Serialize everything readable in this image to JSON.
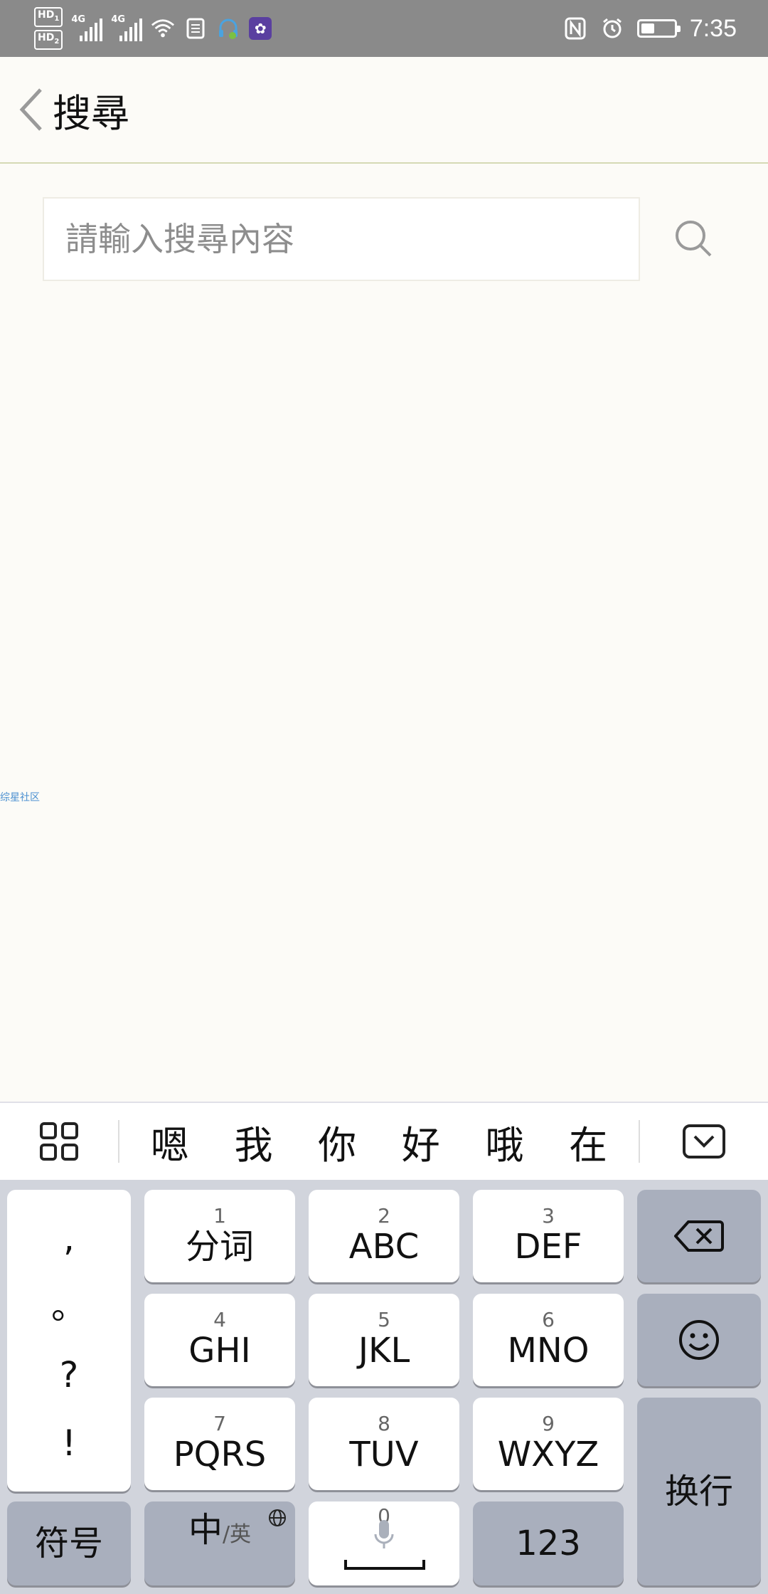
{
  "status_bar": {
    "hd1": "HD",
    "hd1_sub": "1",
    "hd2": "HD",
    "hd2_sub": "2",
    "net1": "4G",
    "net2": "4G",
    "time": "7:35",
    "battery_level": 0.4
  },
  "header": {
    "title": "搜尋"
  },
  "search": {
    "placeholder": "請輸入搜尋內容",
    "value": ""
  },
  "watermark": "综星社区",
  "candidates": [
    "嗯",
    "我",
    "你",
    "好",
    "哦",
    "在"
  ],
  "keyboard": {
    "punct": [
      ",",
      "。",
      "?",
      "!"
    ],
    "keys": [
      {
        "num": "1",
        "label": "分词"
      },
      {
        "num": "2",
        "label": "ABC"
      },
      {
        "num": "3",
        "label": "DEF"
      },
      {
        "num": "4",
        "label": "GHI"
      },
      {
        "num": "5",
        "label": "JKL"
      },
      {
        "num": "6",
        "label": "MNO"
      },
      {
        "num": "7",
        "label": "PQRS"
      },
      {
        "num": "8",
        "label": "TUV"
      },
      {
        "num": "9",
        "label": "WXYZ"
      }
    ],
    "symbols_label": "符号",
    "lang_main": "中",
    "lang_sub": "/英",
    "space_num": "0",
    "numbers_label": "123",
    "enter_label": "换行"
  }
}
